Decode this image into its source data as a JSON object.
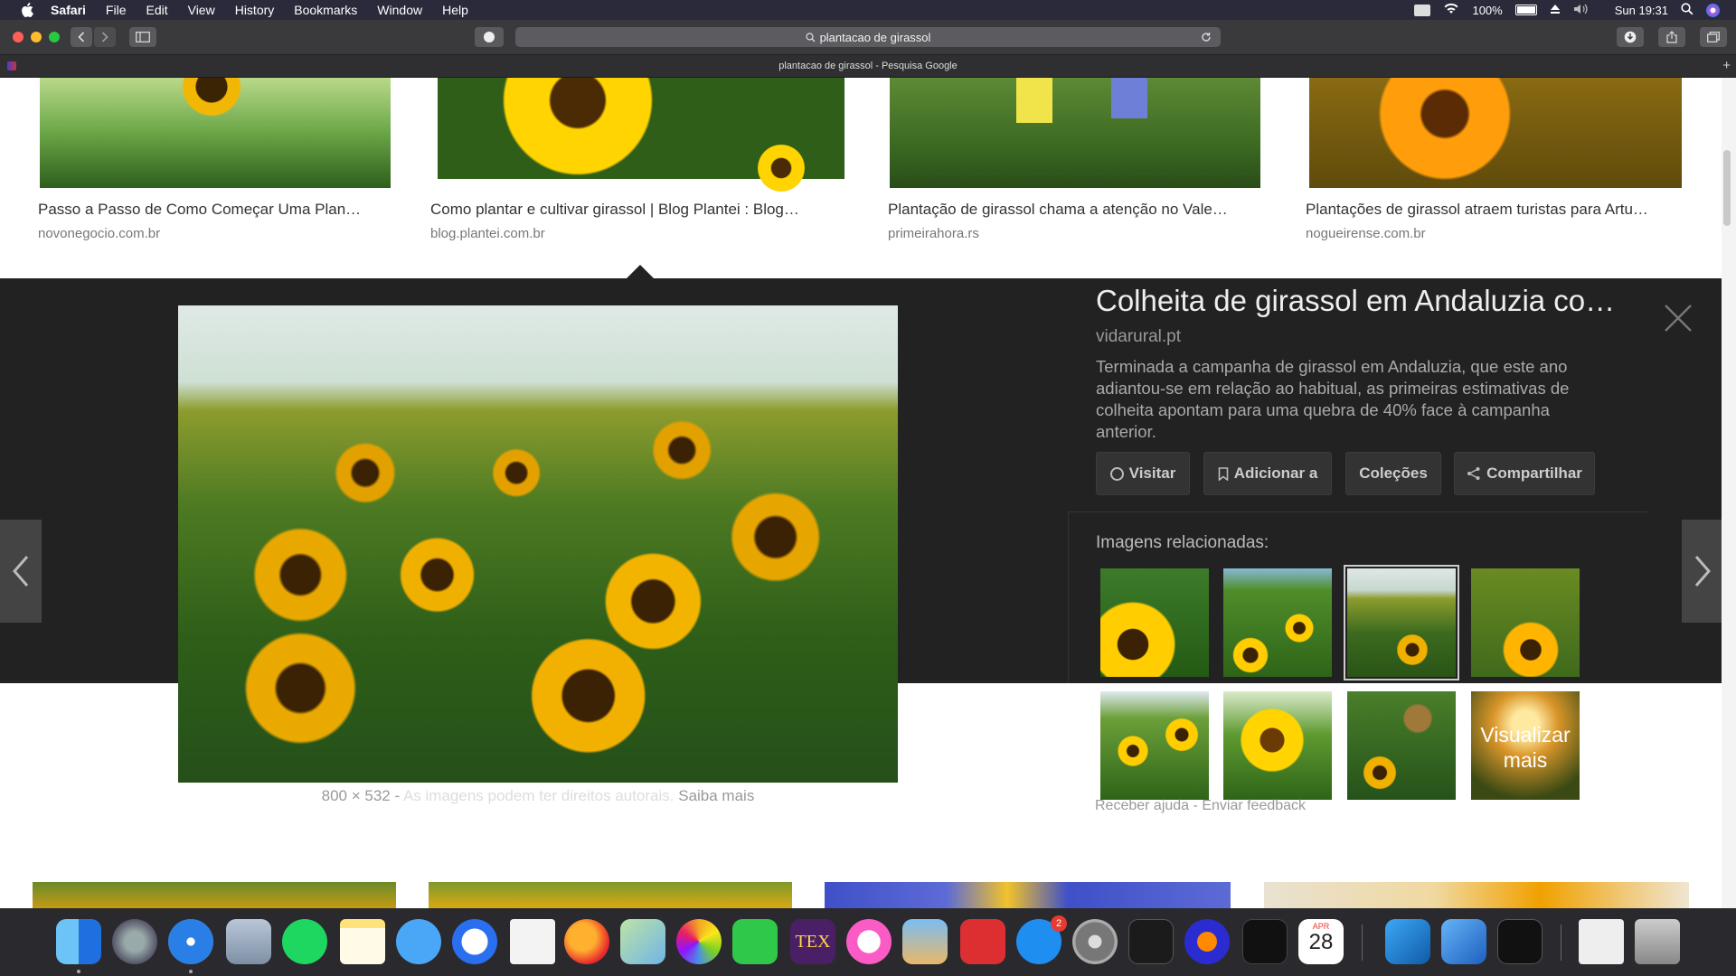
{
  "menubar": {
    "app": "Safari",
    "items": [
      "File",
      "Edit",
      "View",
      "History",
      "Bookmarks",
      "Window",
      "Help"
    ],
    "battery": "100%",
    "clock": "Sun 19:31"
  },
  "toolbar": {
    "url": "plantacao de girassol"
  },
  "tab": {
    "title": "plantacao de girassol - Pesquisa Google"
  },
  "results": [
    {
      "caption": "Passo a Passo de Como Começar Uma Plan…",
      "source": "novonegocio.com.br"
    },
    {
      "caption": "Como plantar e cultivar girassol | Blog Plantei : Blog…",
      "source": "blog.plantei.com.br"
    },
    {
      "caption": "Plantação de girassol chama a atenção no Vale…",
      "source": "primeirahora.rs"
    },
    {
      "caption": "Plantações de girassol atraem turistas para Artu…",
      "source": "nogueirense.com.br"
    }
  ],
  "preview": {
    "title": "Colheita de girassol em Andaluzia co…",
    "site": "vidarural.pt",
    "description": "Terminada a campanha de girassol em Andaluzia, que este ano adiantou-se em relação ao habitual, as primeiras estimativas de colheita apontam para uma quebra de 40% face à campanha anterior.",
    "dimensions": "800 × 532",
    "separator": "-",
    "copyright": "As imagens podem ter direitos autorais.",
    "learn_more": "Saiba mais",
    "buttons": {
      "visit": "Visitar",
      "add": "Adicionar a",
      "collections": "Coleções",
      "share": "Compartilhar"
    },
    "related_header": "Imagens relacionadas:",
    "view_more": "Visualizar mais",
    "help": "Receber ajuda",
    "help_separator": "-",
    "feedback": "Enviar feedback"
  },
  "dock": {
    "calendar_month": "APR",
    "calendar_day": "28",
    "appstore_badge": "2",
    "tex_label": "TEX"
  }
}
